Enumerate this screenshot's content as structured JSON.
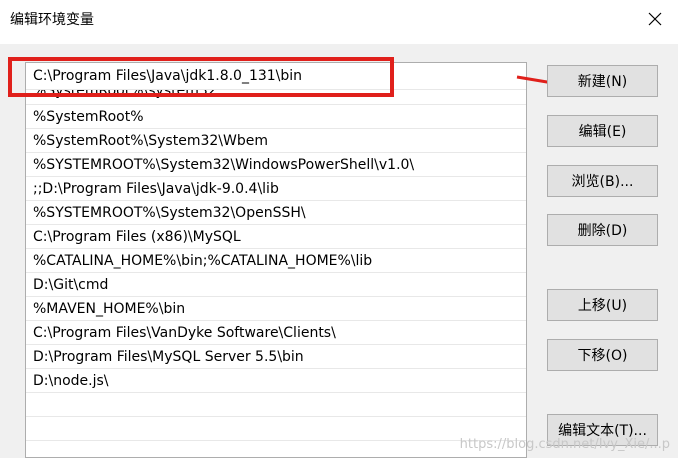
{
  "window": {
    "title": "编辑环境变量"
  },
  "paths": [
    "C:\\Program Files\\Java\\jdk1.8.0_131\\bin",
    "%SystemRoot%\\system32",
    "%SystemRoot%",
    "%SystemRoot%\\System32\\Wbem",
    "%SYSTEMROOT%\\System32\\WindowsPowerShell\\v1.0\\",
    ";;D:\\Program Files\\Java\\jdk-9.0.4\\lib",
    "%SYSTEMROOT%\\System32\\OpenSSH\\",
    "C:\\Program Files (x86)\\MySQL",
    "%CATALINA_HOME%\\bin;%CATALINA_HOME%\\lib",
    "D:\\Git\\cmd",
    "%MAVEN_HOME%\\bin",
    "C:\\Program Files\\VanDyke Software\\Clients\\",
    "D:\\Program Files\\MySQL Server 5.5\\bin",
    "D:\\node.js\\"
  ],
  "buttons": {
    "new": "新建(N)",
    "edit": "编辑(E)",
    "browse": "浏览(B)...",
    "delete": "删除(D)",
    "move_up": "上移(U)",
    "move_down": "下移(O)",
    "edit_text": "编辑文本(T)..."
  },
  "watermark": "https://blog.csdn.net/Ivy_Xie/...p",
  "colors": {
    "annotation": "#e0201b"
  }
}
